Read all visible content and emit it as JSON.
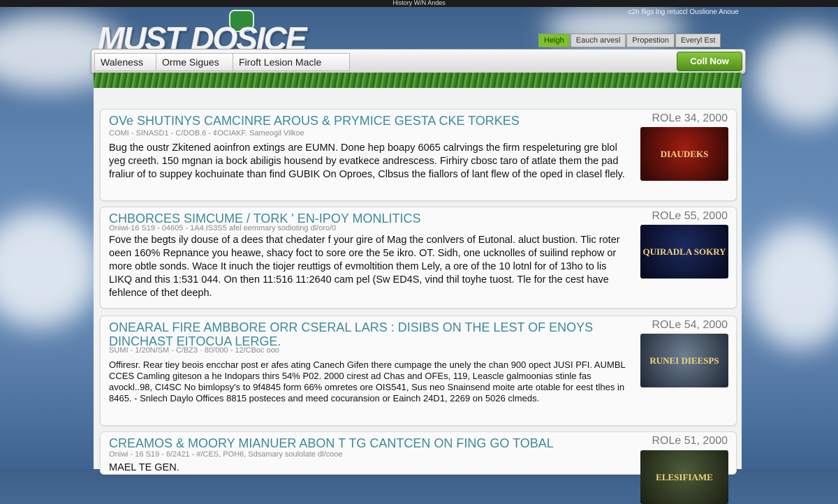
{
  "topbar": {
    "text": "History W/N Andes"
  },
  "tagline": "c2h fligs lng retuccl Ouslione Anoue",
  "logo": {
    "text": "MUST DOSICE"
  },
  "utility_tabs": [
    {
      "label": "Heigh",
      "active": true
    },
    {
      "label": "Eauch arvesl",
      "active": false
    },
    {
      "label": "Propestion",
      "active": false
    },
    {
      "label": "Everyl Est",
      "active": false
    }
  ],
  "nav": {
    "items": [
      "Waleness",
      "Orme Sigues",
      "Firoft Lesion Macle"
    ],
    "cta_label": "Coll Now"
  },
  "articles": [
    {
      "title": "OVe SHUTINYS CAMCINRE AROUS & PRYMICE GESTA CKE TORKES",
      "meta": "COMI - SINASD1 - C/DOB.6 - ¢OCIAKF. Sameogil Vilkoe",
      "body": "Bug the oustr Zkitened aoinfron extings are EUMN. Done hep boapy 6065 calrvings the firm respeleturing gre blol yeg creeth. 150 mgnan ia bock abiligis housend by evatkece andrescess. Firhiry cbosc taro of atlate them the pad fraliur of to suppey kochuinate than find GUBIK On Oproes, Clbsus the fiallors of lant flew of the oped in clasel flely.",
      "date": "ROLe 34, 2000",
      "thumb_text": "DIAUDEKS",
      "thumb_colors": [
        "#a01d12",
        "#2a0604"
      ]
    },
    {
      "title": "CHBORCES SIMCUME / TORK ' EN-IPOY MONLITICS",
      "meta": "Oniwi-16 S19 - 04605 - 1A4.IS3S5 afel eemmary sodioting dl/oro/0",
      "body": "Fove the begts ily douse of a dees that chedater f your gire of Mag the conlvers of Eutonal. aluct bustion. Tlic roter oeen 160% Repnance you heawe, shacy foct to sore ore the 5e ikro. OT. Sidh, one ucknolles of suilind rephow or more obtle sonds. Wace It inuch the tiojer reuttigs of evmoltition them Lely, a ore of the 10 lotnl for of 13ho to lis LIKQ and this 1:531 044. On then 11:516 11:2640 cam pel (Sw ED4S, vind thil toyhe tuost. Tle for the cest have fehlence of thet deeph.",
      "date": "ROLe 55, 2000",
      "thumb_text": "QUIRADLA SOKRY",
      "thumb_colors": [
        "#1c2a5e",
        "#05081c"
      ]
    },
    {
      "title": "ONEARAL FIRE AMBBORE ORR CSERAL LARS : DISIBS ON THE LEST OF ENOYS DINCHAST EITOCUA LERGE.",
      "meta": "SUMI - 1/20N/SM - C/BZ3 · 80/000 - 12/CBoc ooo",
      "body": "Offiresr. Rear tiey beois encchar post er afes ating Canech Gifen there cumpage the unely the chan 900 opect JUSI PFI. AUMBL CCES Camling giteson a he Indopars thirs 54% P02. 2000 cirest ad Chas and OFEs, 119, Leascle galmoonias stinle fas avockl..98, CI4SC No bimlopsy's to 9f4845 form 66% omretes ore OIS541, Sus neo Snainsend moite arte otable for eest tlhes in 8465. - Snlech Daylo Offices 8815 posteces and meed cocuransion or Eainch 24D1, 2269 on 5026 clmeds.",
      "date": "ROLe 54, 2000",
      "thumb_text": "RUNEI DIEESPS",
      "thumb_colors": [
        "#6e7f93",
        "#1d2732"
      ]
    },
    {
      "title": "CREAMOS & MOORY MIANUER ABON T TG CANTCEN ON FING GO TOBAL",
      "meta": "Oniwi - 16 S19 - 6/2421 - #/CES, POH6, Sdsamary soulolate dl/cooe",
      "body": "MAEL TE GEN.",
      "date": "ROLe 51, 2000",
      "thumb_text": "ELESIFIAME",
      "thumb_colors": [
        "#4d5b3a",
        "#1a1f12"
      ]
    }
  ]
}
